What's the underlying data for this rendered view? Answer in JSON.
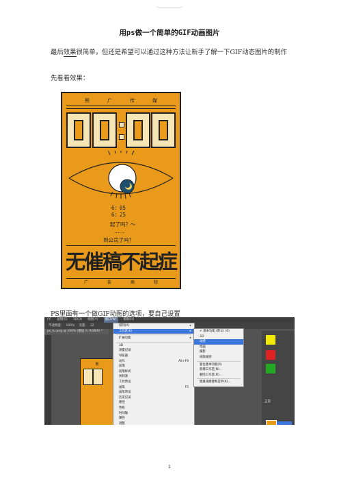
{
  "header": {
    "watermark": ""
  },
  "doc": {
    "title": "用ps做一个简单的GIF动画图片",
    "p1_a": "最后",
    "p1_kw": "效果",
    "p1_b": "很简单，但还是希望可以通过这种方法让新手了解一下GIF动态图片的制作",
    "p2": "先看看效果：",
    "p3": "PS里面有一个做GIF动图的选项，要自己设置"
  },
  "poster": {
    "top": [
      "熊",
      "广",
      "传",
      "媒"
    ],
    "time": "07:00",
    "line1": "6：05",
    "line2": "6：25",
    "q1": "起了吗？～",
    "dots": "……",
    "q2": "到公司了吗？",
    "slogan": "无催稿不起症",
    "bottom": [
      "广",
      "告",
      "病",
      "院"
    ],
    "colors": {
      "bg": "#e99a1b",
      "cream": "#f6e6b5",
      "ink": "#222222",
      "iris": "#1f4f6e"
    }
  },
  "ps": {
    "menubar": [
      "(Y)",
      "滤镜(S)",
      "3D(D)",
      "视图(V)",
      "窗口(W)",
      "帮助(H)"
    ],
    "options": [
      "不透明度:",
      "100%",
      "流量:",
      "32"
    ],
    "doctab": "ps_tu.png @ 100% (图层 0, RGB/8) *",
    "menu1": [
      {
        "label": "排列(A)",
        "arrow": true
      },
      {
        "label": "工作区(K)",
        "arrow": true,
        "selected": true
      },
      {
        "sep": true
      },
      {
        "label": "扩展功能",
        "arrow": true
      },
      {
        "sep": true
      },
      {
        "label": "3D"
      },
      {
        "label": "测量记录"
      },
      {
        "label": "导航器"
      },
      {
        "label": "动作",
        "shortcut": "Alt+F9"
      },
      {
        "label": "段落"
      },
      {
        "label": "段落样式"
      },
      {
        "label": "仿制源"
      },
      {
        "label": "工具预设"
      },
      {
        "label": "画笔",
        "shortcut": "F5"
      },
      {
        "label": "画笔预设"
      },
      {
        "label": "历史记录"
      },
      {
        "label": "路径"
      },
      {
        "label": "色板"
      },
      {
        "label": "时间轴"
      },
      {
        "label": "属性"
      },
      {
        "label": "调整"
      }
    ],
    "menu2": [
      {
        "label": "基本功能 (默认) (E)",
        "check": true
      },
      {
        "label": "3D"
      },
      {
        "label": "动感",
        "selected": true
      },
      {
        "label": "绘画"
      },
      {
        "label": "摄影"
      },
      {
        "label": "排版规则"
      },
      {
        "sep": true
      },
      {
        "label": "复位基本功能(R)"
      },
      {
        "label": "新建工作区(N)..."
      },
      {
        "label": "删除工作区(D)..."
      },
      {
        "sep": true
      },
      {
        "label": "键盘快捷键和菜单(K)..."
      }
    ],
    "panel_label": "正常"
  },
  "footer": {
    "page": "1"
  }
}
